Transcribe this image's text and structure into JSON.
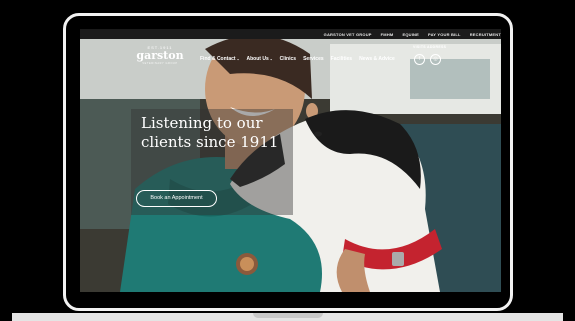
{
  "utility_nav": [
    "GARSTON VET GROUP",
    "FMHM",
    "EQUINE",
    "PAY YOUR BILL",
    "RECRUITMENT"
  ],
  "logo": {
    "established": "EST.1911",
    "name": "garston",
    "subtitle": "VETERINARY GROUP"
  },
  "main_nav": [
    {
      "label": "Find & Contact",
      "has_dropdown": true
    },
    {
      "label": "About Us",
      "has_dropdown": true
    },
    {
      "label": "Clinics",
      "has_dropdown": false
    },
    {
      "label": "Services",
      "has_dropdown": false
    },
    {
      "label": "Facilities",
      "has_dropdown": false
    },
    {
      "label": "News & Advice",
      "has_dropdown": false
    }
  ],
  "visits_label": "VISITS ADDRESS",
  "social": [
    {
      "icon": "facebook-icon",
      "glyph": "f"
    },
    {
      "icon": "instagram-icon",
      "glyph": "◎"
    }
  ],
  "hero": {
    "headline": "Listening to our clients since 1911",
    "cta_label": "Book an Appointment"
  },
  "colors": {
    "utility_bar": "#1b1b1b",
    "scrub_teal": "#1f7a74",
    "collar_red": "#c4232f"
  }
}
